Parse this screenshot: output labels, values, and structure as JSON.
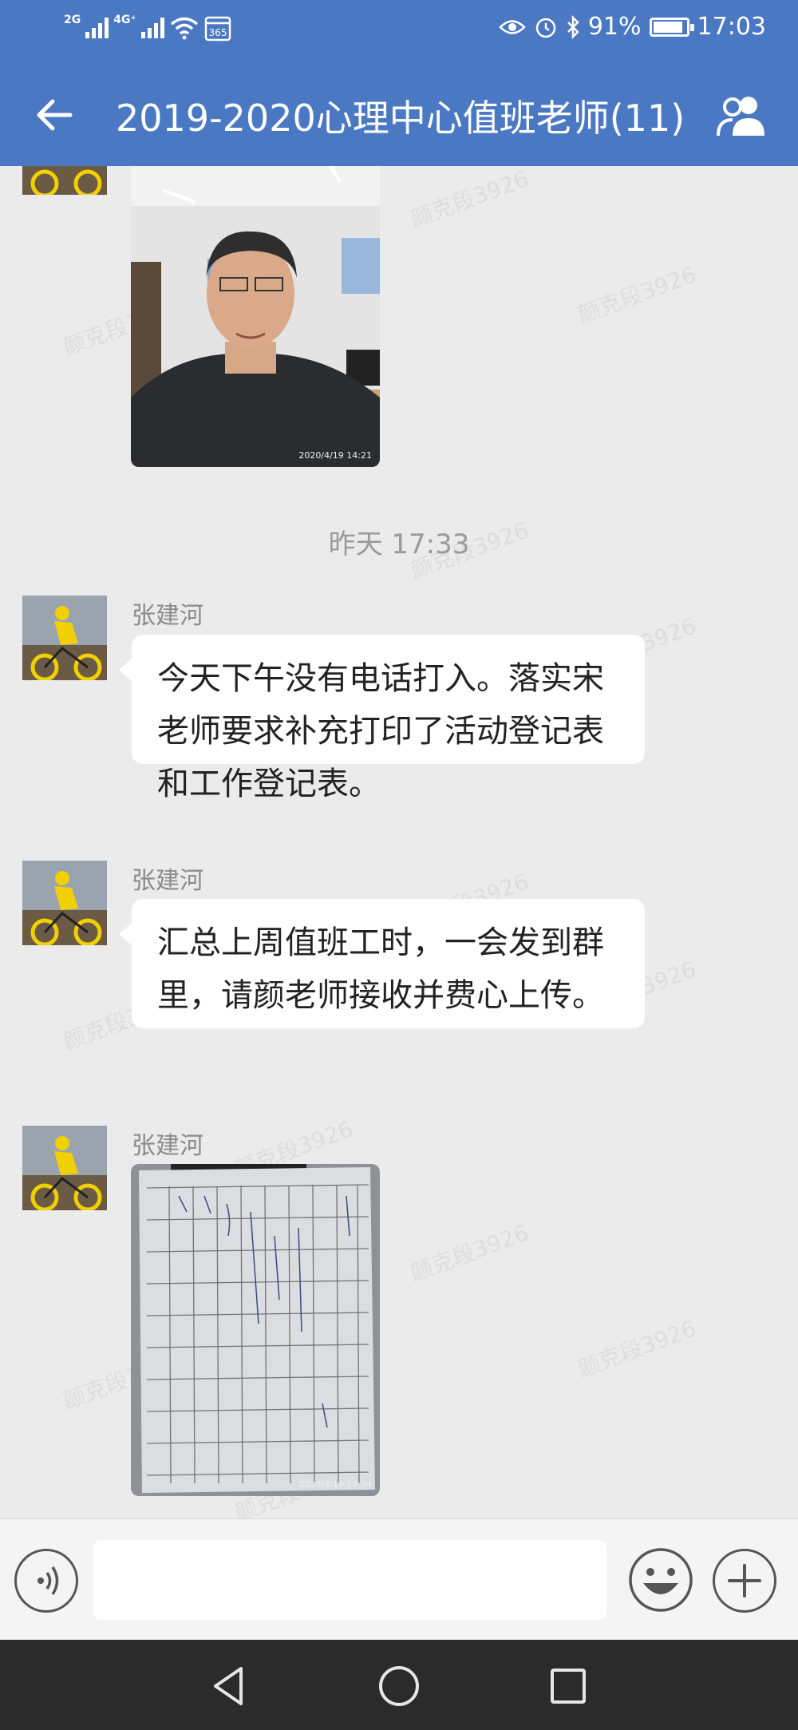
{
  "status_bar": {
    "net1": "2G",
    "net2": "4G⁺",
    "calendar_badge": "365",
    "battery": "91%",
    "battery_level": 0.91,
    "time": "17:03"
  },
  "header": {
    "title": "2019-2020心理中心值班老师(11)"
  },
  "watermark": "颜克段3926",
  "messages": {
    "photo1": {
      "timestamp": "2020/4/19 14:21"
    },
    "divider": "昨天  17:33",
    "msg1": {
      "sender": "张建河",
      "text": "今天下午没有电话打入。落实宋老师要求补充打印了活动登记表和工作登记表。"
    },
    "msg2": {
      "sender": "张建河",
      "text": "汇总上周值班工时，一会发到群里，请颜老师接收并费心上传。"
    },
    "msg3": {
      "sender": "张建河",
      "timestamp": "2020/4/19 17:34"
    }
  },
  "icons": {
    "back": "arrow-left",
    "members": "group-people",
    "voice": "voice-wave",
    "emoji": "smiley-face",
    "more": "plus",
    "nav_back": "triangle",
    "nav_home": "circle",
    "nav_recent": "square"
  },
  "colors": {
    "header": "#4a78c2",
    "chat_bg": "#ebebeb",
    "bubble": "#ffffff",
    "nav": "#2b2b2b"
  }
}
